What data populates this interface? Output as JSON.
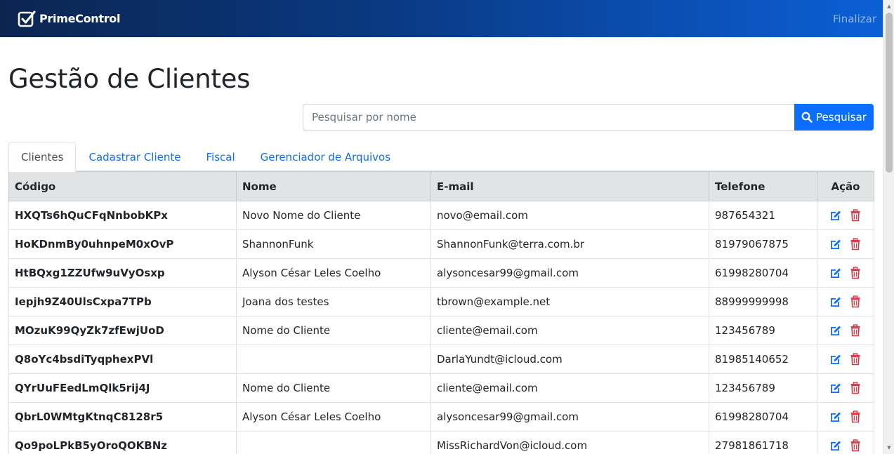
{
  "navbar": {
    "brand": "PrimeControl",
    "logo_icon": "checkbox-logo-icon",
    "finalizar_label": "Finalizar"
  },
  "page": {
    "title": "Gestão de Clientes"
  },
  "search": {
    "placeholder": "Pesquisar por nome",
    "value": "",
    "button_label": "Pesquisar",
    "button_icon": "search-icon"
  },
  "tabs": [
    {
      "label": "Clientes",
      "active": true
    },
    {
      "label": "Cadastrar Cliente",
      "active": false
    },
    {
      "label": "Fiscal",
      "active": false
    },
    {
      "label": "Gerenciador de Arquivos",
      "active": false
    }
  ],
  "table": {
    "headers": {
      "codigo": "Código",
      "nome": "Nome",
      "email": "E-mail",
      "telefone": "Telefone",
      "acao": "Ação"
    },
    "rows": [
      {
        "codigo": "HXQTs6hQuCFqNnbobKPx",
        "nome": "Novo Nome do Cliente",
        "email": "novo@email.com",
        "telefone": "987654321"
      },
      {
        "codigo": "HoKDnmBy0uhnpeM0xOvP",
        "nome": "ShannonFunk",
        "email": "ShannonFunk@terra.com.br",
        "telefone": "81979067875"
      },
      {
        "codigo": "HtBQxg1ZZUfw9uVyOsxp",
        "nome": "Alyson César Leles Coelho",
        "email": "alysoncesar99@gmail.com",
        "telefone": "61998280704"
      },
      {
        "codigo": "Iepjh9Z40UlsCxpa7TPb",
        "nome": "Joana dos testes",
        "email": "tbrown@example.net",
        "telefone": "88999999998"
      },
      {
        "codigo": "MOzuK99QyZk7zfEwjUoD",
        "nome": "Nome do Cliente",
        "email": "cliente@email.com",
        "telefone": "123456789"
      },
      {
        "codigo": "Q8oYc4bsdiTyqphexPVl",
        "nome": "",
        "email": "DarlaYundt@icloud.com",
        "telefone": "81985140652"
      },
      {
        "codigo": "QYrUuFEedLmQlk5rij4J",
        "nome": "Nome do Cliente",
        "email": "cliente@email.com",
        "telefone": "123456789"
      },
      {
        "codigo": "QbrL0WMtgKtnqC8128r5",
        "nome": "Alyson César Leles Coelho",
        "email": "alysoncesar99@gmail.com",
        "telefone": "61998280704"
      },
      {
        "codigo": "Qo9poLPkB5yOroQOKBNz",
        "nome": "",
        "email": "MissRichardVon@icloud.com",
        "telefone": "27981861718"
      }
    ],
    "action_icons": {
      "edit": "edit-icon",
      "delete": "trash-icon"
    }
  },
  "colors": {
    "navbar_start": "#0b2550",
    "navbar_end": "#0b5fd6",
    "primary": "#0d6efd",
    "edit_icon": "#0d6efd",
    "delete_icon": "#dc3545",
    "header_bg": "#e2e3e5"
  }
}
